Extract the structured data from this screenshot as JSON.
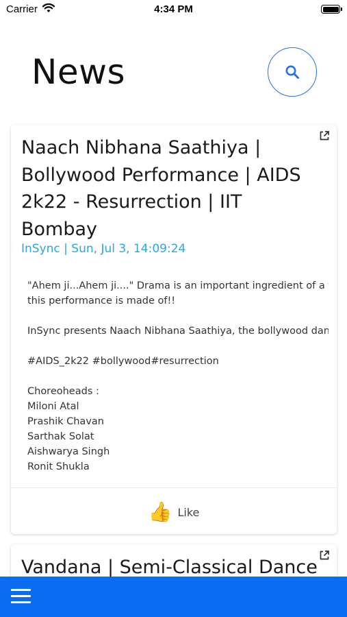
{
  "status_bar": {
    "carrier": "Carrier",
    "time": "4:34 PM"
  },
  "header": {
    "title": "News"
  },
  "posts": [
    {
      "title": "Naach Nibhana Saathiya | Bollywood Performance | AIDS 2k22 - Resurrection | IIT Bombay",
      "meta": "InSync | Sun, Jul 3, 14:09:24",
      "body_lines": [
        "\"Ahem ji...Ahem ji....\" Drama is an important ingredient of a ty",
        "this performance is made of!!",
        "",
        "InSync presents Naach Nibhana Saathiya, the bollywood dan",
        "",
        "#AIDS_2k22 #bollywood#resurrection",
        "",
        "Choreoheads :",
        "Miloni Atal",
        "Prashik Chavan",
        "Sarthak Solat",
        "Aishwarya Singh",
        "Ronit Shukla"
      ],
      "like_label": "Like",
      "like_emoji": "👍"
    },
    {
      "title": "Vandana | Semi-Classical Dance"
    }
  ],
  "colors": {
    "accent": "#2470e8",
    "meta": "#28a8dc",
    "bottom_bar": "#0a6cf0"
  },
  "icons": {
    "search": "search-icon",
    "open_link": "open-in-new-icon",
    "menu": "hamburger-menu-icon",
    "like": "thumbs-up-icon",
    "wifi": "wifi-icon",
    "battery": "battery-icon"
  }
}
